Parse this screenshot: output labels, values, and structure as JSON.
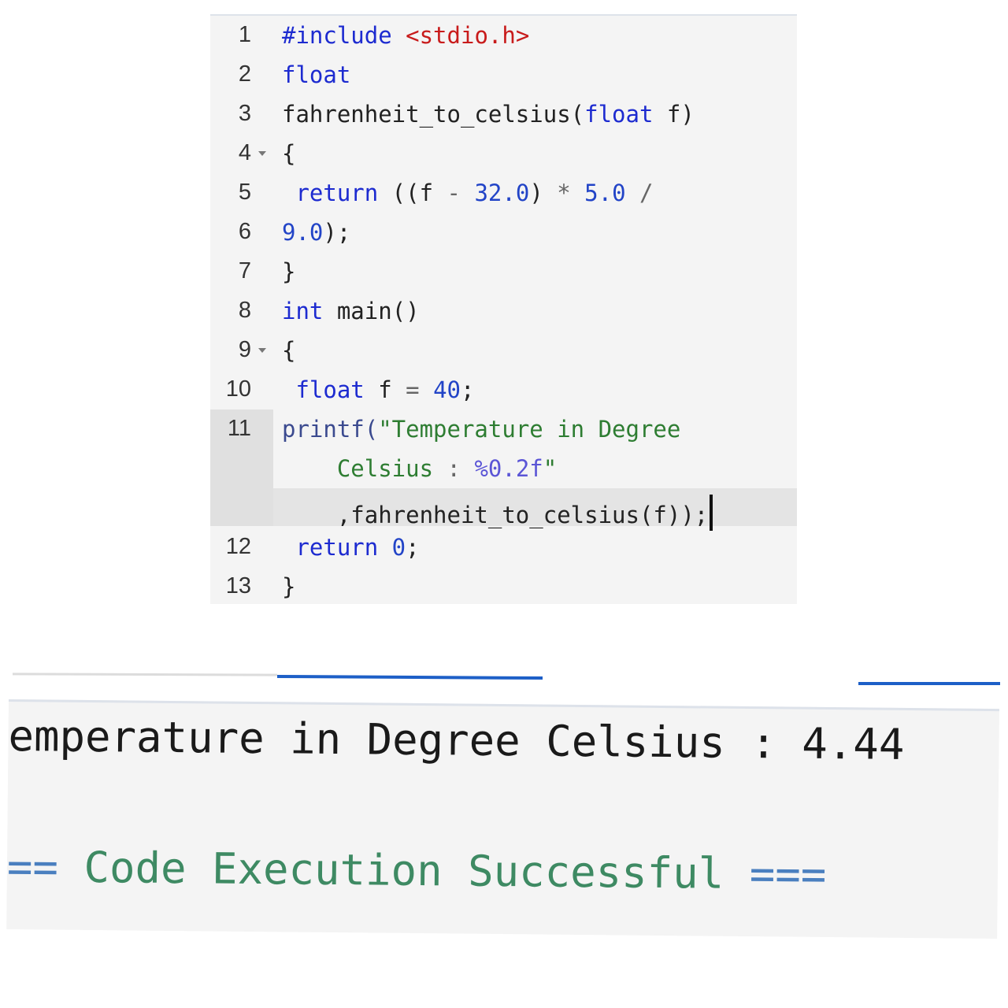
{
  "editor": {
    "lines": [
      {
        "n": "1",
        "t1": "#include ",
        "t2": "<stdio.h>"
      },
      {
        "n": "2",
        "t1": "float"
      },
      {
        "n": "3",
        "t1": "fahrenheit_to_celsius(",
        "t2": "float",
        "t3": " f)"
      },
      {
        "n": "4",
        "t1": "{"
      },
      {
        "n": "5",
        "t1": " return",
        "t2": " ((f ",
        "t3": "-",
        "t4": " 32.0",
        "t5": ") ",
        "t6": "*",
        "t7": " 5.0 ",
        "t8": "/"
      },
      {
        "n": "6",
        "t1": "9.0",
        "t2": ");"
      },
      {
        "n": "7",
        "t1": "}"
      },
      {
        "n": "8",
        "t1": "int",
        "t2": " main()"
      },
      {
        "n": "9",
        "t1": "{"
      },
      {
        "n": "10",
        "t1": " float",
        "t2": " f ",
        "t3": "=",
        "t4": " 40",
        "t5": ";"
      },
      {
        "n": "11",
        "t1": "printf(",
        "t2": "\"Temperature in Degree",
        "t3": "    Celsius ",
        "t4": ":",
        "t5": " %0.2f",
        "t6": "\"",
        "t7": "    ,fahrenheit_to_celsius(f));"
      },
      {
        "n": "12",
        "t1": " return",
        "t2": " 0",
        "t3": ";"
      },
      {
        "n": "13",
        "t1": "}"
      }
    ]
  },
  "console": {
    "output_text": "emperature in Degree Celsius : 4.44",
    "status_prefix": "==",
    "status_text": " Code Execution Successful ",
    "status_suffix": "==="
  }
}
